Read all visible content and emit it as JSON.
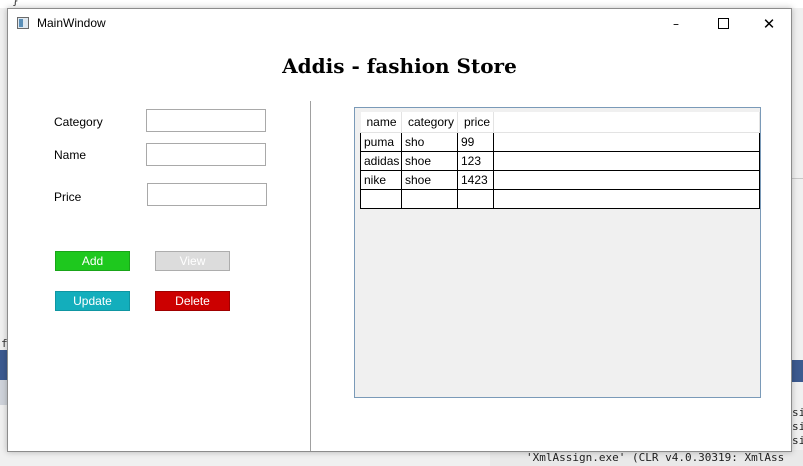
{
  "window": {
    "title": "MainWindow",
    "minimize_glyph": "–",
    "close_glyph": "✕"
  },
  "store_title": "Addis - fashion Store",
  "form": {
    "category_label": "Category",
    "name_label": "Name",
    "price_label": "Price",
    "category_value": "",
    "name_value": "",
    "price_value": ""
  },
  "buttons": {
    "add": "Add",
    "view": "View",
    "update": "Update",
    "delete": "Delete"
  },
  "grid": {
    "columns": [
      "name",
      "category",
      "price"
    ],
    "rows": [
      [
        "puma",
        "sho",
        "99"
      ],
      [
        "adidas",
        "shoe",
        "123"
      ],
      [
        "nike",
        "shoe",
        "1423"
      ],
      [
        "",
        "",
        ""
      ]
    ]
  },
  "background": {
    "brace": "}",
    "left_char": "f",
    "output_line": "'XmlAssign.exe' (CLR v4.0.30319: XmlAss",
    "right_fragment": "si"
  },
  "colors": {
    "add": "#1ec81e",
    "view": "#dcdcdc",
    "update": "#13aebc",
    "delete": "#cc0000"
  }
}
